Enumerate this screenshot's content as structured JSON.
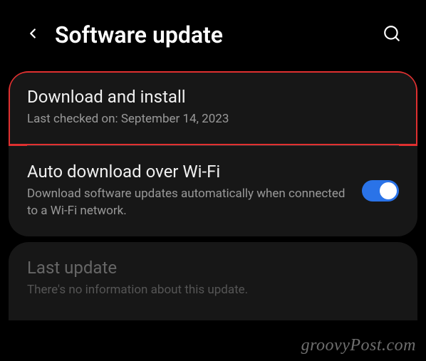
{
  "header": {
    "title": "Software update"
  },
  "items": {
    "download": {
      "title": "Download and install",
      "subtitle": "Last checked on: September 14, 2023"
    },
    "auto": {
      "title": "Auto download over Wi-Fi",
      "subtitle": "Download software updates automatically when connected to a Wi-Fi network.",
      "toggle_on": true
    },
    "last": {
      "title": "Last update",
      "subtitle": "There's no information about this update."
    }
  },
  "watermark": "groovyPost.com"
}
